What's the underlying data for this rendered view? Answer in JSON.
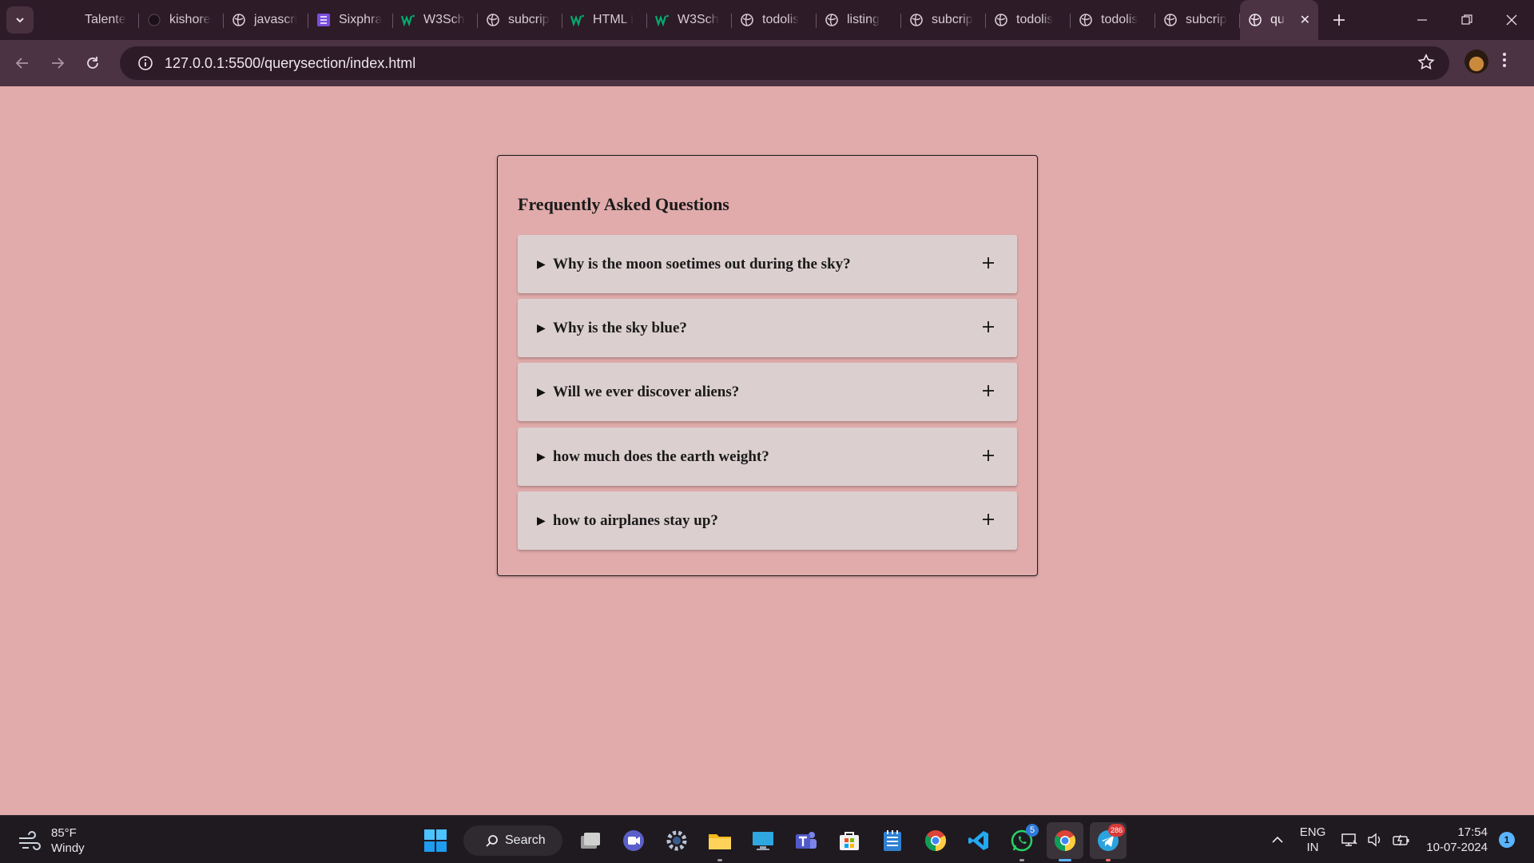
{
  "browser": {
    "tabs": [
      {
        "title": "Talente",
        "icon": "blank-page-icon"
      },
      {
        "title": "kishore",
        "icon": "github-icon"
      },
      {
        "title": "javascri",
        "icon": "globe-icon"
      },
      {
        "title": "Sixphra",
        "icon": "list-app-icon"
      },
      {
        "title": "W3Sch",
        "icon": "w3schools-icon"
      },
      {
        "title": "subcrip",
        "icon": "globe-icon"
      },
      {
        "title": "HTML i",
        "icon": "w3schools-icon"
      },
      {
        "title": "W3Sch",
        "icon": "w3schools-icon"
      },
      {
        "title": "todolis",
        "icon": "globe-icon"
      },
      {
        "title": "listing",
        "icon": "globe-icon"
      },
      {
        "title": "subcrip",
        "icon": "globe-icon"
      },
      {
        "title": "todolis",
        "icon": "globe-icon"
      },
      {
        "title": "todolis",
        "icon": "globe-icon"
      },
      {
        "title": "subcrip",
        "icon": "globe-icon"
      }
    ],
    "active_tab": {
      "title": "qu",
      "icon": "globe-icon"
    },
    "url": "127.0.0.1:5500/querysection/index.html"
  },
  "page": {
    "title": "Frequently Asked Questions",
    "background": "#e1abab",
    "questions": [
      "Why is the moon soetimes out during the sky?",
      "Why is the sky blue?",
      "Will we ever discover aliens?",
      "how much does the earth weight?",
      "how to airplanes stay up?"
    ],
    "expand_symbol": "+"
  },
  "taskbar": {
    "weather": {
      "temp": "85°F",
      "condition": "Windy"
    },
    "search_label": "Search",
    "whatsapp_badge": "5",
    "telegram_badge": "286",
    "language": {
      "line1": "ENG",
      "line2": "IN"
    },
    "time": "17:54",
    "date": "10-07-2024",
    "notification_count": "1"
  }
}
